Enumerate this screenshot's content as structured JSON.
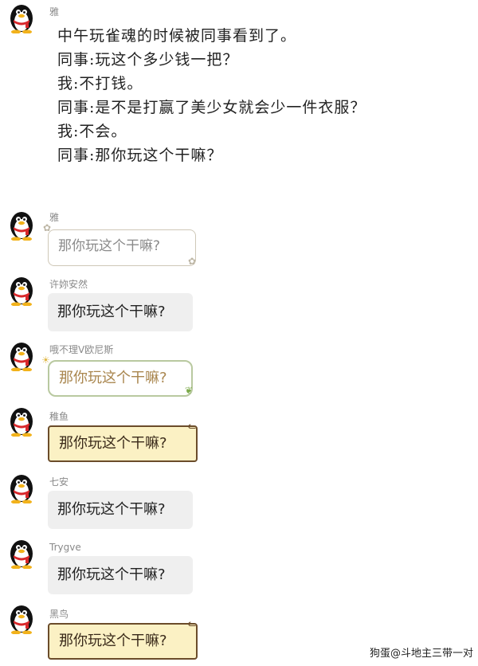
{
  "messages": {
    "m1": {
      "sender": "雅",
      "lines": [
        "中午玩雀魂的时候被同事看到了。",
        "同事:玩这个多少钱一把？",
        "我:不打钱。",
        "同事:是不是打赢了美少女就会少一件衣服？",
        "我:不会。",
        "同事:那你玩这个干嘛？"
      ]
    },
    "m2": {
      "sender": "雅",
      "text": "那你玩这个干嘛?"
    },
    "m3": {
      "sender": "许妳安然",
      "text": "那你玩这个干嘛?"
    },
    "m4": {
      "sender": "哦不理V欧尼斯",
      "text": "那你玩这个干嘛?"
    },
    "m5": {
      "sender": "稚鱼",
      "text": "那你玩这个干嘛?"
    },
    "m6": {
      "sender": "七安",
      "text": "那你玩这个干嘛?"
    },
    "m7": {
      "sender": "Trygve",
      "text": "那你玩这个干嘛?"
    },
    "m8": {
      "sender": "黑鸟",
      "text": "那你玩这个干嘛?"
    }
  },
  "footer": "狗蛋@斗地主三带一对",
  "icons": {
    "avatar": "qq-penguin-icon"
  },
  "colors": {
    "gray_bubble": "#efefef",
    "yellow_bubble": "#fbf1c4",
    "green_border": "#b9c9a0"
  }
}
